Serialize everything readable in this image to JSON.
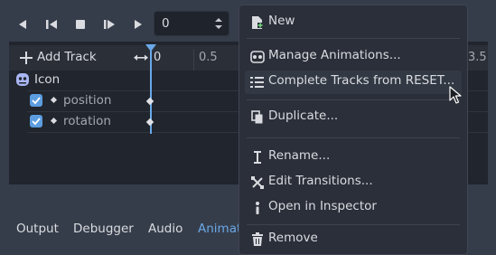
{
  "playback": {
    "frame_value": "0"
  },
  "tracks": {
    "add_track_label": "Add Track",
    "ruler": [
      "0",
      "0.5",
      "3.5"
    ],
    "node_name": "Icon",
    "items": [
      "position",
      "rotation"
    ]
  },
  "bottom_tabs": [
    "Output",
    "Debugger",
    "Audio",
    "Animat"
  ],
  "menu": {
    "items": [
      {
        "label": "New",
        "icon": "new-file-icon"
      },
      {
        "label": "Manage Animations...",
        "icon": "animation-library-icon"
      },
      {
        "label": "Complete Tracks from RESET...",
        "icon": "complete-tracks-icon"
      },
      {
        "label": "Duplicate...",
        "icon": "duplicate-icon"
      },
      {
        "label": "Rename...",
        "icon": "rename-icon"
      },
      {
        "label": "Edit Transitions...",
        "icon": "transitions-icon"
      },
      {
        "label": "Open in Inspector",
        "icon": "inspector-icon"
      },
      {
        "label": "Remove",
        "icon": "trash-icon"
      }
    ]
  },
  "colors": {
    "accent": "#5c9de0",
    "menu_bg": "#2a2f39",
    "panel_bg": "#21252d",
    "app_bg": "#363d4a"
  }
}
